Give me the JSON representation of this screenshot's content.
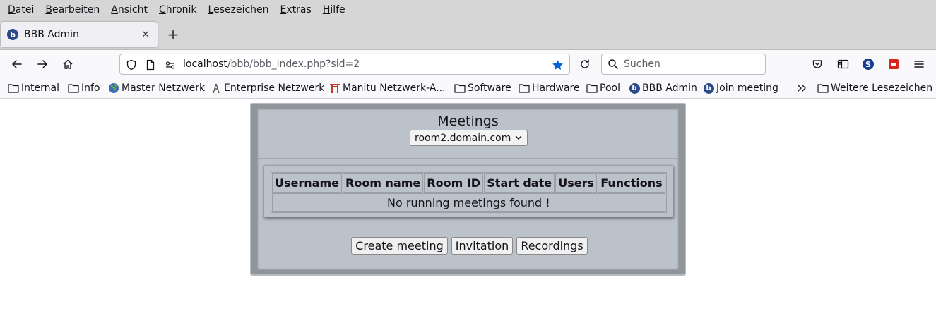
{
  "menubar": {
    "items": [
      {
        "key": "D",
        "rest": "atei"
      },
      {
        "key": "B",
        "rest": "earbeiten"
      },
      {
        "key": "A",
        "rest": "nsicht"
      },
      {
        "key": "C",
        "rest": "hronik"
      },
      {
        "key": "L",
        "rest": "esezeichen"
      },
      {
        "key": "E",
        "rest": "xtras"
      },
      {
        "key": "H",
        "rest": "ilfe"
      }
    ]
  },
  "tab": {
    "title": "BBB Admin",
    "close": "×",
    "new_tab": "+"
  },
  "urlbar": {
    "host": "localhost",
    "path": "/bbb/bbb_index.php?sid=2"
  },
  "search": {
    "placeholder": "Suchen"
  },
  "bookmarks": {
    "items": [
      "Internal",
      "Info",
      "Master Netzwerk",
      "Enterprise Netzwerk",
      "Manitu Netzwerk-A...",
      "Software",
      "Hardware",
      "Pool",
      "BBB Admin",
      "Join meeting"
    ],
    "more": "Weitere Lesezeichen"
  },
  "page": {
    "title": "Meetings",
    "server_select": "room2.domain.com",
    "table": {
      "headers": [
        "Username",
        "Room name",
        "Room ID",
        "Start date",
        "Users",
        "Functions"
      ],
      "empty_message": "No running meetings found !"
    },
    "buttons": {
      "create": "Create meeting",
      "invitation": "Invitation",
      "recordings": "Recordings"
    }
  },
  "colors": {
    "panel": "#bcc2ca",
    "outer": "#8f959b",
    "accent": "#0061e0"
  }
}
